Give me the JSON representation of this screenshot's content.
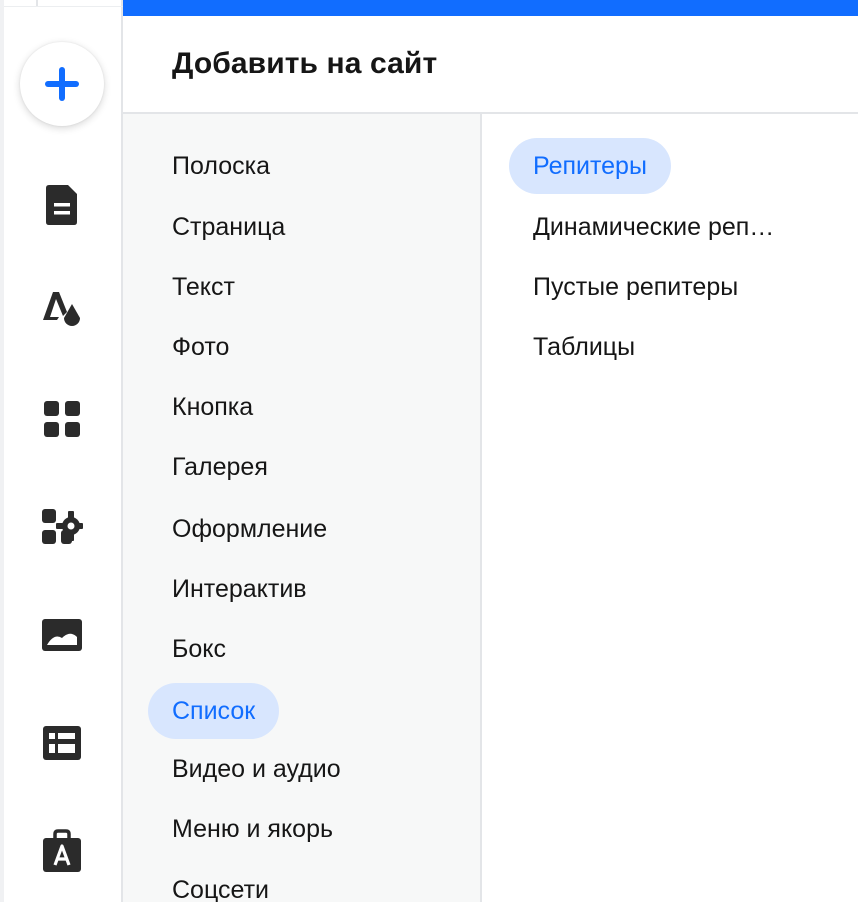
{
  "panel": {
    "title": "Добавить на сайт"
  },
  "rail": {
    "items": [
      {
        "icon": "plus-icon"
      },
      {
        "icon": "page-icon"
      },
      {
        "icon": "theme-icon"
      },
      {
        "icon": "apps-icon"
      },
      {
        "icon": "app-settings-icon"
      },
      {
        "icon": "image-icon"
      },
      {
        "icon": "table-icon"
      },
      {
        "icon": "app-market-icon"
      }
    ]
  },
  "categories": [
    {
      "label": "Полоска"
    },
    {
      "label": "Страница"
    },
    {
      "label": "Текст"
    },
    {
      "label": "Фото"
    },
    {
      "label": "Кнопка"
    },
    {
      "label": "Галерея"
    },
    {
      "label": "Оформление"
    },
    {
      "label": "Интерактив"
    },
    {
      "label": "Бокс"
    },
    {
      "label": "Список",
      "selected": true
    },
    {
      "label": "Видео и аудио"
    },
    {
      "label": "Меню и якорь"
    },
    {
      "label": "Соцсети"
    }
  ],
  "subcategories": [
    {
      "label": "Репитеры",
      "selected": true
    },
    {
      "label": "Динамические реп…"
    },
    {
      "label": "Пустые репитеры"
    },
    {
      "label": "Таблицы"
    }
  ],
  "colors": {
    "accent": "#116dff",
    "selected_bg": "#d8e6fe",
    "icon": "#2b2b2b",
    "text": "#161616"
  }
}
